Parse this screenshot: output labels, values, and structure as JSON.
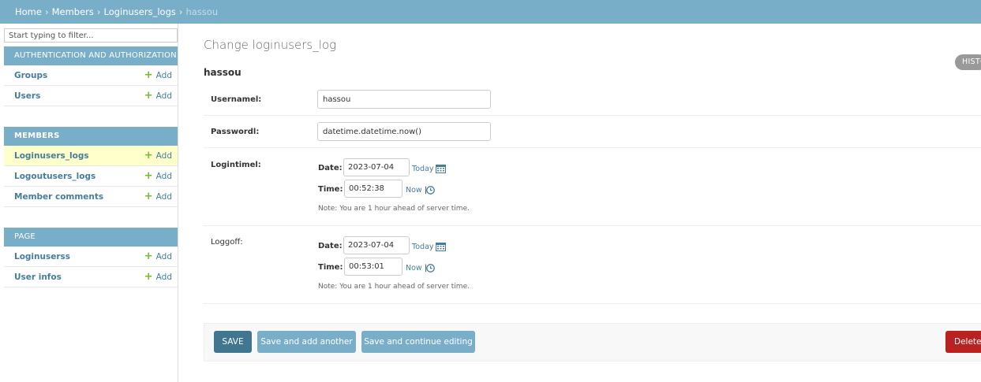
{
  "breadcrumb": {
    "home": "Home",
    "members": "Members",
    "model": "Loginusers_logs",
    "current": "hassou",
    "separator": "›"
  },
  "sidebar": {
    "filter_placeholder": "Start typing to filter...",
    "modules": [
      {
        "title": "AUTHENTICATION AND AUTHORIZATION",
        "rows": [
          {
            "name": "Groups",
            "add": "Add"
          },
          {
            "name": "Users",
            "add": "Add"
          }
        ]
      },
      {
        "title": "MEMBERS",
        "rows": [
          {
            "name": "Loginusers_logs",
            "add": "Add"
          },
          {
            "name": "Logoutusers_logs",
            "add": "Add"
          },
          {
            "name": "Member comments",
            "add": "Add"
          }
        ]
      },
      {
        "title": "PAGE",
        "rows": [
          {
            "name": "Loginuserss",
            "add": "Add"
          },
          {
            "name": "User infos",
            "add": "Add"
          }
        ]
      }
    ]
  },
  "main": {
    "title": "Change loginusers_log",
    "history_label": "HISTO",
    "object_name": "hassou",
    "fields": {
      "username": {
        "label": "Usernamel:",
        "value": "hassou"
      },
      "password": {
        "label": "Passwordl:",
        "value": "datetime.datetime.now()"
      },
      "logintime": {
        "label": "Logintimel:",
        "date_label": "Date:",
        "date_value": "2023-07-04",
        "today_link": "Today",
        "time_label": "Time:",
        "time_value": "00:52:38",
        "now_link": "Now",
        "note": "Note: You are 1 hour ahead of server time."
      },
      "loggoff": {
        "label": "Loggoff:",
        "date_label": "Date:",
        "date_value": "2023-07-04",
        "today_link": "Today",
        "time_label": "Time:",
        "time_value": "00:53:01",
        "now_link": "Now",
        "note": "Note: You are 1 hour ahead of server time."
      }
    },
    "pipe": "|",
    "buttons": {
      "save": "SAVE",
      "save_add": "Save and add another",
      "save_continue": "Save and continue editing",
      "delete": "Delete"
    }
  },
  "colors": {
    "header_bg": "#79aec8",
    "link": "#447e9b",
    "add_plus": "#70bf2b",
    "save_button": "#417690",
    "delete_button": "#ba2121",
    "selected_row": "#ffffcc"
  },
  "icons": {
    "calendar": "calendar-icon",
    "clock": "clock-icon",
    "add": "add-plus-icon"
  }
}
